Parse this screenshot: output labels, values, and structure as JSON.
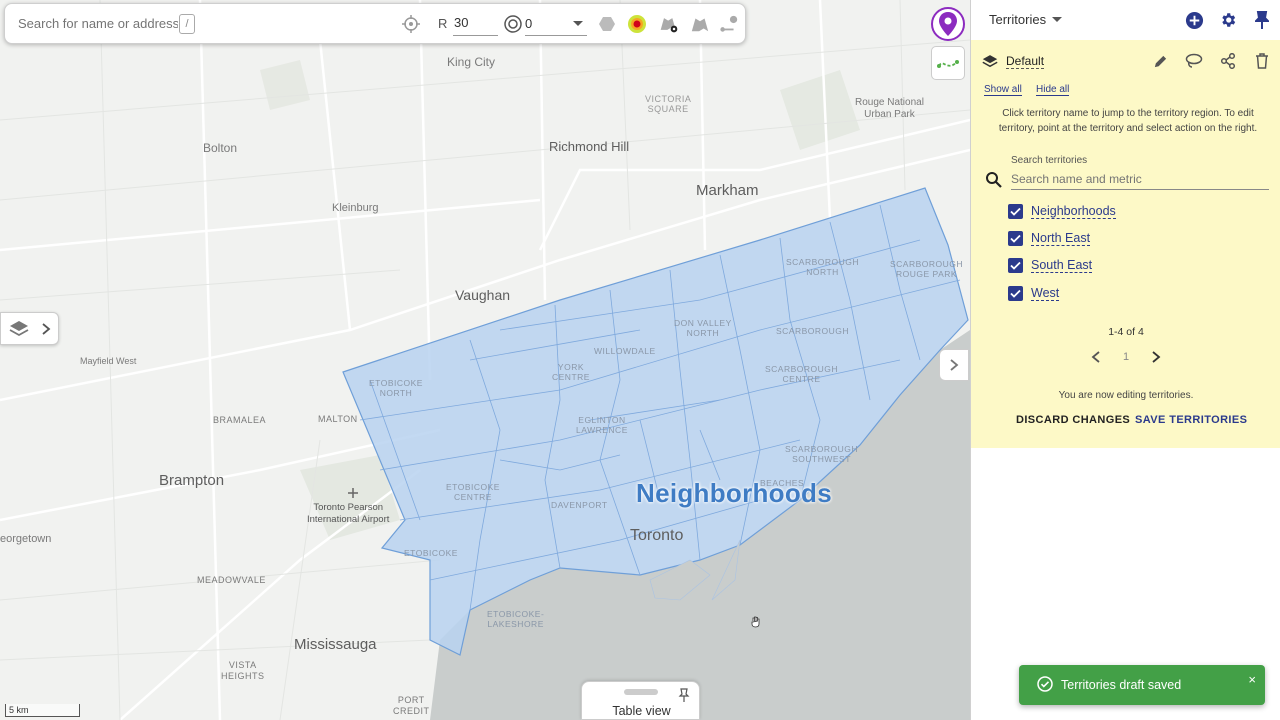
{
  "toolbar": {
    "search_placeholder": "Search for name or address",
    "shortcut_key": "/",
    "radius_label": "R",
    "radius_value": "30",
    "ring_value": "0"
  },
  "map": {
    "territory_label": "Neighborhoods",
    "scale_label": "5 km",
    "table_view_label": "Table view",
    "places": {
      "king_city": "King City",
      "victoria_square": "VICTORIA\nSQUARE",
      "rouge_park": "Rouge National\nUrban Park",
      "bolton": "Bolton",
      "richmond_hill": "Richmond Hill",
      "markham": "Markham",
      "kleinburg": "Kleinburg",
      "vaughan": "Vaughan",
      "scarborough_north": "SCARBOROUGH\nNORTH",
      "scarborough_rouge": "SCARBOROUGH\nROUGE PARK",
      "mayfield_west": "Mayfield West",
      "don_valley_north": "DON VALLEY\nNORTH",
      "scarborough": "SCARBOROUGH",
      "willowdale": "WILLOWDALE",
      "york_centre": "YORK\nCENTRE",
      "etobicoke_north": "ETOBICOKE\nNORTH",
      "scarborough_centre": "SCARBOROUGH\nCENTRE",
      "bramalea": "BRAMALEA",
      "malton": "MALTON",
      "eglinton": "EGLINTON\nLAWRENCE",
      "scarborough_sw": "SCARBOROUGH\nSOUTHWEST",
      "brampton": "Brampton",
      "pearson": "Toronto Pearson\nInternational Airport",
      "etobicoke_centre": "ETOBICOKE\nCENTRE",
      "davenport": "DAVENPORT",
      "beaches": "BEACHES",
      "georgetown": "eorgetown",
      "toronto": "Toronto",
      "etobicoke": "ETOBICOKE",
      "meadowvale": "MEADOWVALE",
      "etobicoke_lakeshore": "ETOBICOKE-\nLAKESHORE",
      "mississauga": "Mississauga",
      "vista_heights": "VISTA\nHEIGHTS",
      "port_credit": "PORT\nCREDIT"
    }
  },
  "panel": {
    "title": "Territories",
    "layer_name": "Default",
    "show_all": "Show all",
    "hide_all": "Hide all",
    "help_text": "Click territory name to jump to the territory region. To edit territory, point at the territory and select action on the right.",
    "search_label": "Search territories",
    "search_placeholder": "Search name and metric",
    "territories": [
      {
        "name": "Neighborhoods",
        "checked": true
      },
      {
        "name": "North East",
        "checked": true
      },
      {
        "name": "South East",
        "checked": true
      },
      {
        "name": "West",
        "checked": true
      }
    ],
    "pager_count": "1-4 of 4",
    "pager_page": "1",
    "editing_text": "You are now editing territories.",
    "discard_label": "DISCARD CHANGES",
    "save_label": "SAVE TERRITORIES"
  },
  "toast": {
    "text": "Territories draft saved",
    "close": "×"
  },
  "colors": {
    "accent": "#2b3a8c",
    "territory_fill": "#b9d2f0",
    "territory_stroke": "#6f9fd8",
    "panel_highlight": "#fdf9c7",
    "toast": "#43a047",
    "pin": "#8c2bbf"
  }
}
